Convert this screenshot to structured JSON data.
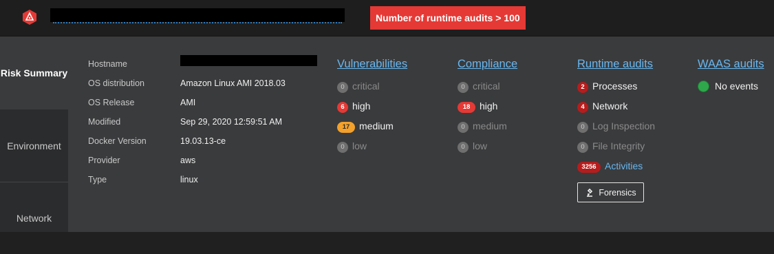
{
  "alert": {
    "text": "Number of runtime audits > 100",
    "color": "#e53935"
  },
  "sidenav": {
    "items": [
      {
        "label": "Risk Summary"
      },
      {
        "label": "Environment"
      },
      {
        "label": "Network"
      }
    ]
  },
  "details": {
    "rows": [
      {
        "label": "Hostname",
        "value": ""
      },
      {
        "label": "OS distribution",
        "value": "Amazon Linux AMI 2018.03"
      },
      {
        "label": "OS Release",
        "value": "AMI"
      },
      {
        "label": "Modified",
        "value": "Sep 29, 2020 12:59:51 AM"
      },
      {
        "label": "Docker Version",
        "value": "19.03.13-ce"
      },
      {
        "label": "Provider",
        "value": "aws"
      },
      {
        "label": "Type",
        "value": "linux"
      }
    ]
  },
  "vulnerabilities": {
    "title": "Vulnerabilities",
    "items": [
      {
        "count": "0",
        "label": "critical"
      },
      {
        "count": "6",
        "label": "high"
      },
      {
        "count": "17",
        "label": "medium"
      },
      {
        "count": "0",
        "label": "low"
      }
    ]
  },
  "compliance": {
    "title": "Compliance",
    "items": [
      {
        "count": "0",
        "label": "critical"
      },
      {
        "count": "18",
        "label": "high"
      },
      {
        "count": "0",
        "label": "medium"
      },
      {
        "count": "0",
        "label": "low"
      }
    ]
  },
  "runtime": {
    "title": "Runtime audits",
    "items": [
      {
        "count": "2",
        "label": "Processes"
      },
      {
        "count": "4",
        "label": "Network"
      },
      {
        "count": "0",
        "label": "Log Inspection"
      },
      {
        "count": "0",
        "label": "File Integrity"
      },
      {
        "count": "3256",
        "label": "Activities"
      }
    ],
    "forensics_label": "Forensics"
  },
  "waas": {
    "title": "WAAS audits",
    "status": "No events"
  },
  "colors": {
    "link": "#68b7f0",
    "high": "#e53935",
    "medium": "#f3a12b",
    "runtime": "#b71c1c",
    "ok": "#2ea84b"
  }
}
